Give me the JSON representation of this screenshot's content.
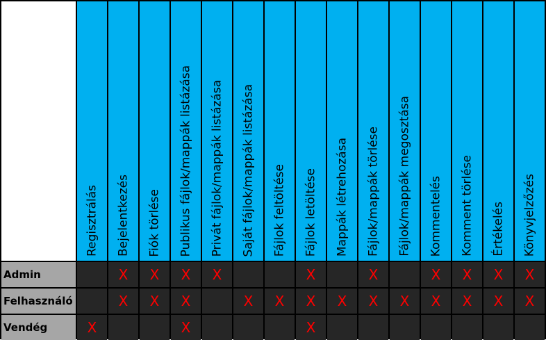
{
  "columns": [
    "Regisztrálás",
    "Bejelentkezés",
    "Fiók törlése",
    "Publikus fájlok/mappák listázása",
    "Privát fájlok/mappák listázása",
    "Saját fájlok/mappák listázása",
    "Fájlok feltöltése",
    "Fájlok letöltése",
    "Mappák létrehozása",
    "Fájlok/mappák törlése",
    "Fájlok/mappák megosztása",
    "Kommentelés",
    "Komment törlése",
    "Értékelés",
    "Könyvjelzőzés"
  ],
  "rows": [
    {
      "label": "Admin",
      "cells": [
        "",
        "X",
        "X",
        "X",
        "X",
        "",
        "",
        "X",
        "",
        "X",
        "",
        "X",
        "X",
        "X",
        "X"
      ]
    },
    {
      "label": "Felhasználó",
      "cells": [
        "",
        "X",
        "X",
        "X",
        "",
        "X",
        "X",
        "X",
        "X",
        "X",
        "X",
        "X",
        "X",
        "X",
        "X"
      ]
    },
    {
      "label": "Vendég",
      "cells": [
        "X",
        "",
        "",
        "X",
        "",
        "",
        "",
        "X",
        "",
        "",
        "",
        "",
        "",
        "",
        ""
      ]
    }
  ],
  "colors": {
    "header_bg": "#00b0f0",
    "row_label_bg": "#a6a6a6",
    "cell_bg": "#262626",
    "mark": "#ff0000"
  }
}
